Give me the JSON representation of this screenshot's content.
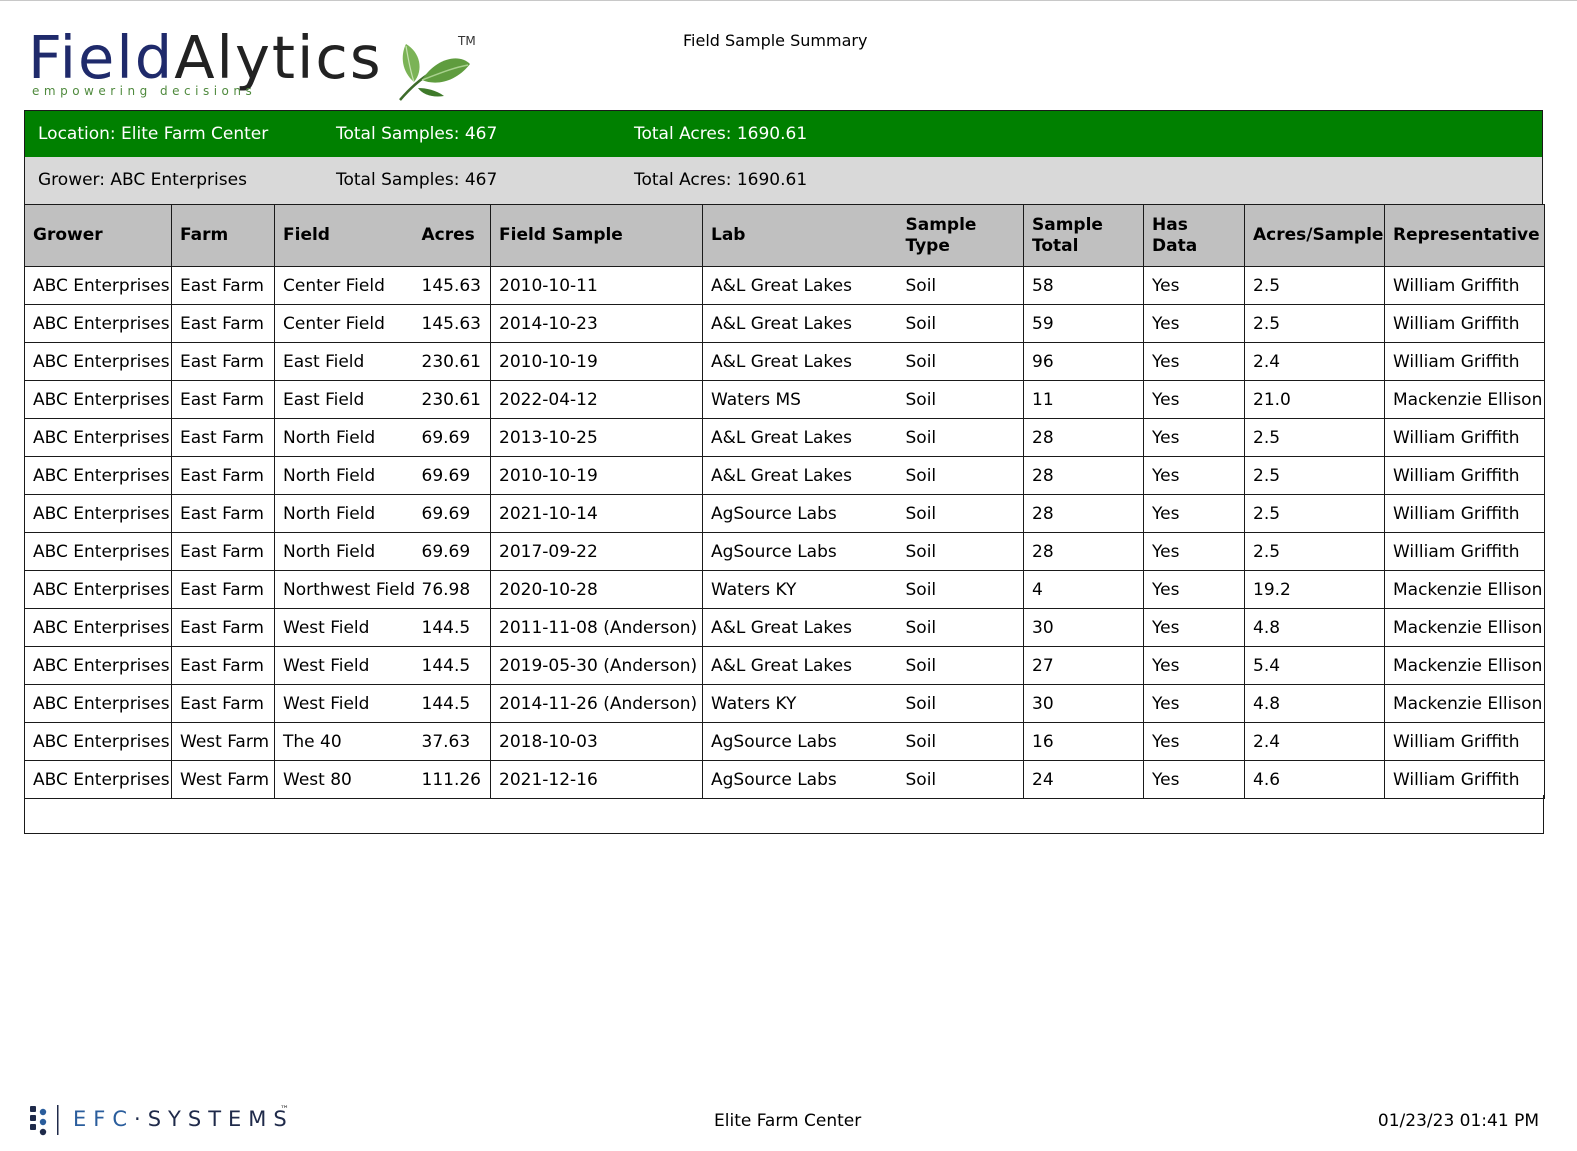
{
  "header": {
    "logo_primary": "Field",
    "logo_secondary": "Alytics",
    "logo_tagline": "empowering decisions",
    "logo_tm": "TM",
    "report_title": "Field Sample Summary"
  },
  "location_band": {
    "location": "Location: Elite Farm Center",
    "total_samples": "Total Samples: 467",
    "total_acres": "Total Acres: 1690.61",
    "background_color": "#008000"
  },
  "grower_band": {
    "grower": "Grower: ABC Enterprises",
    "total_samples": "Total Samples: 467",
    "total_acres": "Total Acres: 1690.61",
    "background_color": "#d9d9d9"
  },
  "table": {
    "columns": [
      "Grower",
      "Farm",
      "Field",
      "Acres",
      "Field Sample",
      "Lab",
      "Sample Type",
      "Sample Total",
      "Has Data",
      "Acres/Sample",
      "Representative"
    ],
    "rows": [
      [
        "ABC Enterprises",
        "East Farm",
        "Center Field",
        "145.63",
        "2010-10-11",
        "A&L Great Lakes",
        "Soil",
        "58",
        "Yes",
        "2.5",
        "William Griffith"
      ],
      [
        "ABC Enterprises",
        "East Farm",
        "Center Field",
        "145.63",
        "2014-10-23",
        "A&L Great Lakes",
        "Soil",
        "59",
        "Yes",
        "2.5",
        "William Griffith"
      ],
      [
        "ABC Enterprises",
        "East Farm",
        "East Field",
        "230.61",
        "2010-10-19",
        "A&L Great Lakes",
        "Soil",
        "96",
        "Yes",
        "2.4",
        "William Griffith"
      ],
      [
        "ABC Enterprises",
        "East Farm",
        "East Field",
        "230.61",
        "2022-04-12",
        "Waters MS",
        "Soil",
        "11",
        "Yes",
        "21.0",
        "Mackenzie Ellison"
      ],
      [
        "ABC Enterprises",
        "East Farm",
        "North Field",
        "69.69",
        "2013-10-25",
        "A&L Great Lakes",
        "Soil",
        "28",
        "Yes",
        "2.5",
        "William Griffith"
      ],
      [
        "ABC Enterprises",
        "East Farm",
        "North Field",
        "69.69",
        "2010-10-19",
        "A&L Great Lakes",
        "Soil",
        "28",
        "Yes",
        "2.5",
        "William Griffith"
      ],
      [
        "ABC Enterprises",
        "East Farm",
        "North Field",
        "69.69",
        "2021-10-14",
        "AgSource Labs",
        "Soil",
        "28",
        "Yes",
        "2.5",
        "William Griffith"
      ],
      [
        "ABC Enterprises",
        "East Farm",
        "North Field",
        "69.69",
        "2017-09-22",
        "AgSource Labs",
        "Soil",
        "28",
        "Yes",
        "2.5",
        "William Griffith"
      ],
      [
        "ABC Enterprises",
        "East Farm",
        "Northwest Field",
        "76.98",
        "2020-10-28",
        "Waters KY",
        "Soil",
        "4",
        "Yes",
        "19.2",
        "Mackenzie Ellison"
      ],
      [
        "ABC Enterprises",
        "East Farm",
        "West Field",
        "144.5",
        "2011-11-08 (Anderson)",
        "A&L Great Lakes",
        "Soil",
        "30",
        "Yes",
        "4.8",
        "Mackenzie Ellison"
      ],
      [
        "ABC Enterprises",
        "East Farm",
        "West Field",
        "144.5",
        "2019-05-30 (Anderson)",
        "A&L Great Lakes",
        "Soil",
        "27",
        "Yes",
        "5.4",
        "Mackenzie Ellison"
      ],
      [
        "ABC Enterprises",
        "East Farm",
        "West Field",
        "144.5",
        "2014-11-26 (Anderson)",
        "Waters KY",
        "Soil",
        "30",
        "Yes",
        "4.8",
        "Mackenzie Ellison"
      ],
      [
        "ABC Enterprises",
        "West Farm",
        "The 40",
        "37.63",
        "2018-10-03",
        "AgSource Labs",
        "Soil",
        "16",
        "Yes",
        "2.4",
        "William Griffith"
      ],
      [
        "ABC Enterprises",
        "West Farm",
        "West 80",
        "111.26",
        "2021-12-16",
        "AgSource Labs",
        "Soil",
        "24",
        "Yes",
        "4.6",
        "William Griffith"
      ]
    ],
    "header_color": "#c0c0c0"
  },
  "footer": {
    "brand_prefix": "EFC",
    "brand_suffix": "SYSTEMS",
    "brand_tm": "™",
    "center_text": "Elite Farm Center",
    "timestamp": "01/23/23 01:41 PM"
  }
}
